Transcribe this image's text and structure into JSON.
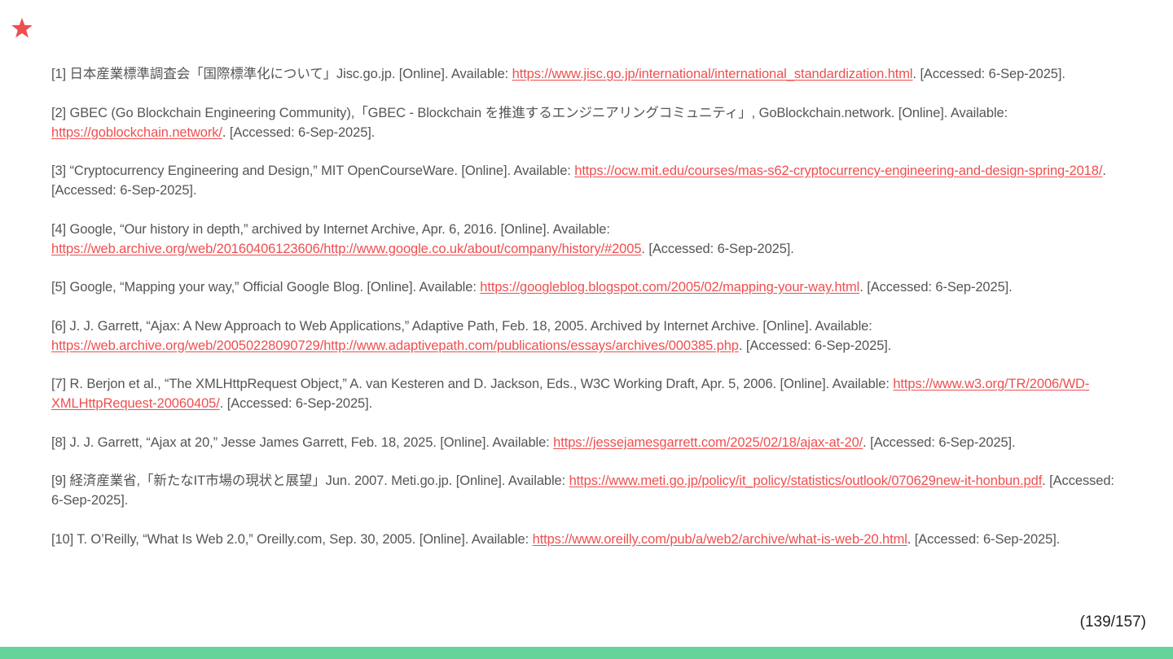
{
  "colors": {
    "accent": "#ef4f4f",
    "footer": "#66d39a",
    "text": "#555555"
  },
  "icons": {
    "header": "star-icon"
  },
  "references": [
    {
      "before": "[1] 日本産業標準調査会「国際標準化について」Jisc.go.jp. [Online]. Available: ",
      "url": "https://www.jisc.go.jp/international/international_standardization.html",
      "after": ". [Accessed: 6-Sep-2025]."
    },
    {
      "before": "[2] GBEC (Go Blockchain Engineering Community),「GBEC - Blockchain を推進するエンジニアリングコミュニティ」, GoBlockchain.network. [Online]. Available: ",
      "url": "https://goblockchain.network/",
      "after": ". [Accessed: 6-Sep-2025]."
    },
    {
      "before": "[3] “Cryptocurrency Engineering and Design,” MIT OpenCourseWare. [Online]. Available: ",
      "url": "https://ocw.mit.edu/courses/mas-s62-cryptocurrency-engineering-and-design-spring-2018/",
      "after": ". [Accessed: 6-Sep-2025]."
    },
    {
      "before": "[4] Google, “Our history in depth,” archived by Internet Archive, Apr. 6, 2016. [Online]. Available: ",
      "url": "https://web.archive.org/web/20160406123606/http://www.google.co.uk/about/company/history/#2005",
      "after": ". [Accessed: 6-Sep-2025]."
    },
    {
      "before": "[5] Google, “Mapping your way,” Official Google Blog. [Online]. Available: ",
      "url": "https://googleblog.blogspot.com/2005/02/mapping-your-way.html",
      "after": ". [Accessed: 6-Sep-2025]."
    },
    {
      "before": "[6] J. J. Garrett, “Ajax: A New Approach to Web Applications,” Adaptive Path, Feb. 18, 2005. Archived by Internet Archive. [Online]. Available: ",
      "url": "https://web.archive.org/web/20050228090729/http://www.adaptivepath.com/publications/essays/archives/000385.php",
      "after": ". [Accessed: 6-Sep-2025]."
    },
    {
      "before": "[7] R. Berjon et al., “The XMLHttpRequest Object,” A. van Kesteren and D. Jackson, Eds., W3C Working Draft, Apr. 5, 2006. [Online]. Available: ",
      "url": "https://www.w3.org/TR/2006/WD-XMLHttpRequest-20060405/",
      "after": ". [Accessed: 6-Sep-2025]."
    },
    {
      "before": "[8] J. J. Garrett, “Ajax at 20,” Jesse James Garrett, Feb. 18, 2025. [Online]. Available: ",
      "url": "https://jessejamesgarrett.com/2025/02/18/ajax-at-20/",
      "after": ". [Accessed: 6-Sep-2025]."
    },
    {
      "before": "[9] 経済産業省,「新たなIT市場の現状と展望」Jun. 2007. Meti.go.jp. [Online]. Available: ",
      "url": "https://www.meti.go.jp/policy/it_policy/statistics/outlook/070629new-it-honbun.pdf",
      "after": ". [Accessed: 6-Sep-2025]."
    },
    {
      "before": "[10] T. O’Reilly, “What Is Web 2.0,” Oreilly.com, Sep. 30, 2005. [Online]. Available: ",
      "url": "https://www.oreilly.com/pub/a/web2/archive/what-is-web-20.html",
      "after": ". [Accessed: 6-Sep-2025]."
    }
  ],
  "page_number": "(139/157)"
}
